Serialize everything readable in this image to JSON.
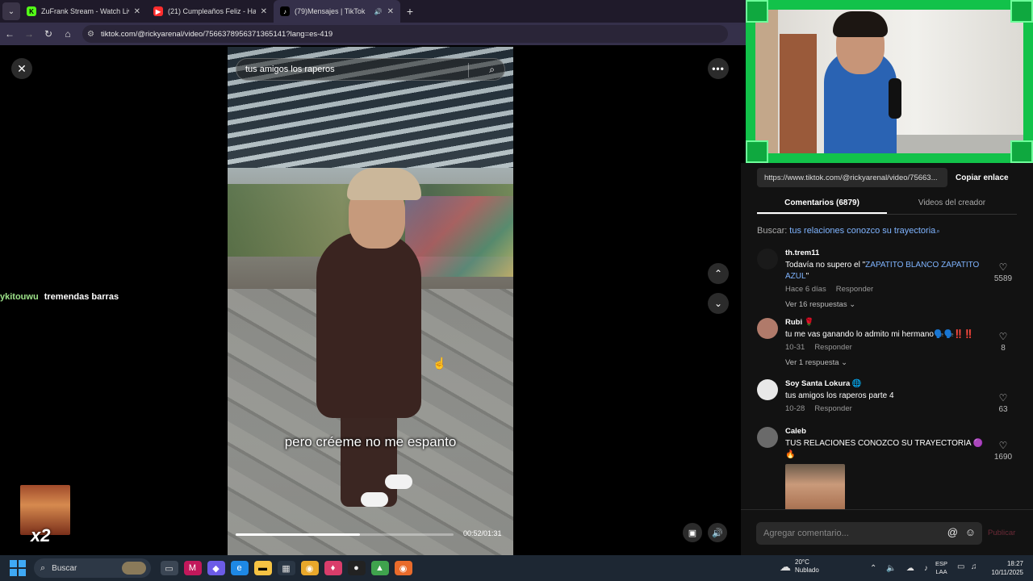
{
  "browser": {
    "tabs": [
      {
        "title": "ZuFrank Stream - Watch Live on",
        "favicon": "K",
        "favicon_color": "#53fc18",
        "active": false
      },
      {
        "title": "(21) Cumpleaños Feliz - Happy",
        "favicon": "▶",
        "favicon_color": "#ff2d2d",
        "active": false
      },
      {
        "title": "(79)Mensajes | TikTok",
        "favicon": "♪",
        "favicon_color": "#ffffff",
        "active": true
      }
    ],
    "url": "tiktok.com/@rickyarenal/video/7566378956371365141?lang=es-419"
  },
  "video": {
    "search_query": "tus amigos los raperos",
    "caption": "pero créeme no me espanto",
    "time": "00:52/01:31",
    "progress": 0.571
  },
  "stream_chat": {
    "user": "ykitouwu",
    "message": "tremendas barras"
  },
  "emote": {
    "multiplier": "x2"
  },
  "panel": {
    "link": "https://www.tiktok.com/@rickyarenal/video/75663...",
    "copy_label": "Copiar enlace",
    "tabs": [
      "Comentarios (6879)",
      "Videos del creador"
    ],
    "search_prefix": "Buscar:",
    "search_term": "tus relaciones conozco su trayectoria",
    "comments": [
      {
        "name": "th.trem11",
        "text_prefix": "Todavía no supero el \"",
        "text_highlight": "ZAPATITO BLANCO ZAPATITO AZUL",
        "text_suffix": "\"",
        "meta_time": "Hace 6 días",
        "reply_label": "Responder",
        "replies": "Ver 16 respuestas ⌄",
        "likes": "5589"
      },
      {
        "name": "Rubi 🌹",
        "text": "tu me vas ganando lo admito mi hermano🗣️🗣️‼️‼️",
        "meta_time": "10-31",
        "reply_label": "Responder",
        "replies": "Ver 1 respuesta ⌄",
        "likes": "8"
      },
      {
        "name": "Soy Santa Lokura 🌐",
        "text": "tus amigos los raperos parte 4",
        "meta_time": "10-28",
        "reply_label": "Responder",
        "likes": "63"
      },
      {
        "name": "Caleb",
        "text": "TUS RELACIONES CONOZCO SU TRAYECTORIA 🟣🔥",
        "likes": "1690"
      }
    ],
    "compose_placeholder": "Agregar comentario...",
    "post_label": "Publicar"
  },
  "taskbar": {
    "search_label": "Buscar",
    "weather_temp": "20°C",
    "weather_desc": "Nublado",
    "lang_line1": "ESP",
    "lang_line2": "LAA",
    "time": "18:27",
    "date": "10/11/2025"
  }
}
